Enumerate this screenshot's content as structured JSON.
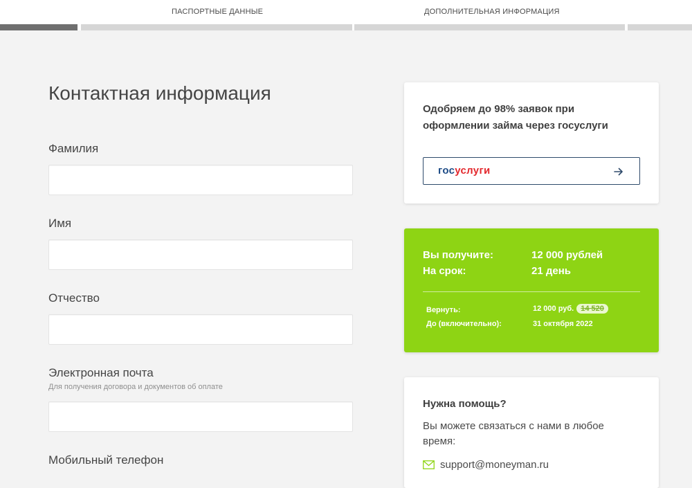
{
  "steps": [
    {
      "label": "ПАСПОРТНЫЕ ДАННЫЕ"
    },
    {
      "label": "ДОПОЛНИТЕЛЬНАЯ ИНФОРМАЦИЯ"
    }
  ],
  "form": {
    "title": "Контактная информация",
    "fields": [
      {
        "label": "Фамилия",
        "value": ""
      },
      {
        "label": "Имя",
        "value": ""
      },
      {
        "label": "Отчество",
        "value": ""
      },
      {
        "label": "Электронная почта",
        "hint": "Для получения договора и документов об оплате",
        "value": ""
      },
      {
        "label": "Мобильный телефон"
      }
    ]
  },
  "gosuslugi_card": {
    "text": "Одобряем до 98% заявок при оформлении займа через госуслуги",
    "logo_part1": "гос",
    "logo_part2": "услуги",
    "logo_colors": {
      "part1": "#1d4b86",
      "part2": "#e3292e"
    },
    "button_icon": "arrow-right-icon"
  },
  "offer_card": {
    "accent": "#8ed414",
    "amount_label": "Вы получите:",
    "amount_value": "12 000 рублей",
    "term_label": "На срок:",
    "term_value": "21 день",
    "return_label": "Вернуть:",
    "return_value": "12 000 руб.",
    "return_old_value": "14 520",
    "due_label": "До (включительно):",
    "due_value": "31 октября 2022"
  },
  "help_card": {
    "title": "Нужна помощь?",
    "text": "Вы можете связаться с нами в любое время:",
    "email": "support@moneyman.ru",
    "email_icon": "mail-icon"
  }
}
